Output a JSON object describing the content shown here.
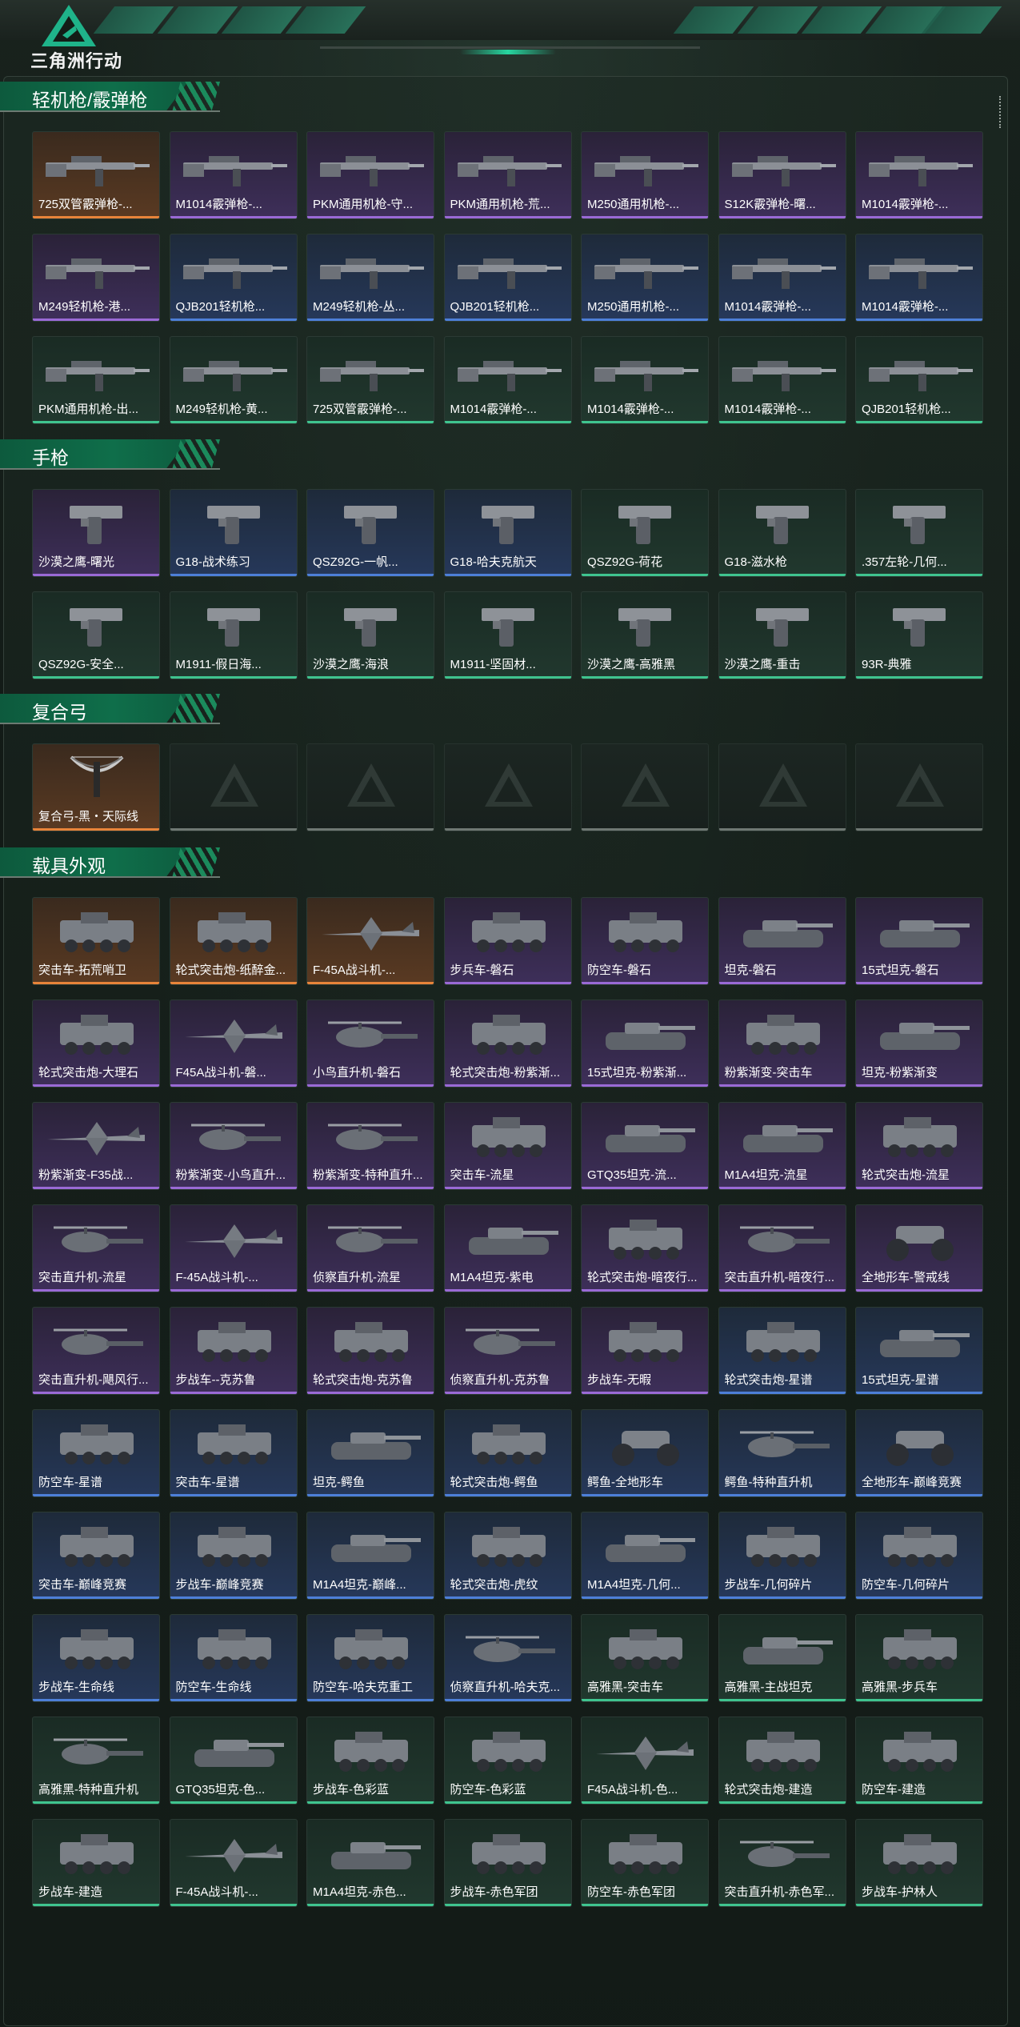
{
  "header": {
    "logo_text": "三角洲行动"
  },
  "sections": [
    {
      "title": "轻机枪/霰弹枪",
      "items": [
        {
          "label": "725双管霰弹枪-...",
          "rarity": "orange",
          "art": "gun-icon"
        },
        {
          "label": "M1014霰弹枪-...",
          "rarity": "purple",
          "art": "gun-icon"
        },
        {
          "label": "PKM通用机枪-守...",
          "rarity": "purple",
          "art": "gun-icon"
        },
        {
          "label": "PKM通用机枪-荒...",
          "rarity": "purple",
          "art": "gun-icon"
        },
        {
          "label": "M250通用机枪-...",
          "rarity": "purple",
          "art": "gun-icon"
        },
        {
          "label": "S12K霰弹枪-曙...",
          "rarity": "purple",
          "art": "gun-icon"
        },
        {
          "label": "M1014霰弹枪-...",
          "rarity": "purple",
          "art": "gun-icon"
        },
        {
          "label": "M249轻机枪-港...",
          "rarity": "purple",
          "art": "gun-icon"
        },
        {
          "label": "QJB201轻机枪...",
          "rarity": "blue",
          "art": "gun-icon"
        },
        {
          "label": "M249轻机枪-丛...",
          "rarity": "blue",
          "art": "gun-icon"
        },
        {
          "label": "QJB201轻机枪...",
          "rarity": "blue",
          "art": "gun-icon"
        },
        {
          "label": "M250通用机枪-...",
          "rarity": "blue",
          "art": "gun-icon"
        },
        {
          "label": "M1014霰弹枪-...",
          "rarity": "blue",
          "art": "gun-icon"
        },
        {
          "label": "M1014霰弹枪-...",
          "rarity": "blue",
          "art": "gun-icon"
        },
        {
          "label": "PKM通用机枪-出...",
          "rarity": "green",
          "art": "gun-icon"
        },
        {
          "label": "M249轻机枪-黄...",
          "rarity": "green",
          "art": "gun-icon"
        },
        {
          "label": "725双管霰弹枪-...",
          "rarity": "green",
          "art": "gun-icon"
        },
        {
          "label": "M1014霰弹枪-...",
          "rarity": "green",
          "art": "gun-icon"
        },
        {
          "label": "M1014霰弹枪-...",
          "rarity": "green",
          "art": "gun-icon"
        },
        {
          "label": "M1014霰弹枪-...",
          "rarity": "green",
          "art": "gun-icon"
        },
        {
          "label": "QJB201轻机枪...",
          "rarity": "green",
          "art": "gun-icon"
        }
      ]
    },
    {
      "title": "手枪",
      "items": [
        {
          "label": "沙漠之鹰-曙光",
          "rarity": "purple",
          "art": "pistol-icon"
        },
        {
          "label": "G18-战术练习",
          "rarity": "blue",
          "art": "pistol-icon"
        },
        {
          "label": "QSZ92G-一帆...",
          "rarity": "blue",
          "art": "pistol-icon"
        },
        {
          "label": "G18-哈夫克航天",
          "rarity": "blue",
          "art": "pistol-icon"
        },
        {
          "label": "QSZ92G-荷花",
          "rarity": "green",
          "art": "pistol-icon"
        },
        {
          "label": "G18-滋水枪",
          "rarity": "green",
          "art": "pistol-icon"
        },
        {
          "label": ".357左轮-几何...",
          "rarity": "green",
          "art": "pistol-icon"
        },
        {
          "label": "QSZ92G-安全...",
          "rarity": "green",
          "art": "pistol-icon"
        },
        {
          "label": "M1911-假日海...",
          "rarity": "green",
          "art": "pistol-icon"
        },
        {
          "label": "沙漠之鹰-海浪",
          "rarity": "green",
          "art": "pistol-icon"
        },
        {
          "label": "M1911-坚固材...",
          "rarity": "green",
          "art": "pistol-icon"
        },
        {
          "label": "沙漠之鹰-高雅黑",
          "rarity": "green",
          "art": "pistol-icon"
        },
        {
          "label": "沙漠之鹰-重击",
          "rarity": "green",
          "art": "pistol-icon"
        },
        {
          "label": "93R-典雅",
          "rarity": "green",
          "art": "pistol-icon"
        }
      ]
    },
    {
      "title": "复合弓",
      "items": [
        {
          "label": "复合弓-黑・天际线",
          "rarity": "orange",
          "art": "bow-icon"
        },
        {
          "label": "",
          "rarity": "empty",
          "art": "placeholder-logo-icon"
        },
        {
          "label": "",
          "rarity": "empty",
          "art": "placeholder-logo-icon"
        },
        {
          "label": "",
          "rarity": "empty",
          "art": "placeholder-logo-icon"
        },
        {
          "label": "",
          "rarity": "empty",
          "art": "placeholder-logo-icon"
        },
        {
          "label": "",
          "rarity": "empty",
          "art": "placeholder-logo-icon"
        },
        {
          "label": "",
          "rarity": "empty",
          "art": "placeholder-logo-icon"
        }
      ]
    },
    {
      "title": "载具外观",
      "items": [
        {
          "label": "突击车-拓荒哨卫",
          "rarity": "orange",
          "art": "vehicle-icon"
        },
        {
          "label": "轮式突击炮-纸醉金...",
          "rarity": "orange",
          "art": "vehicle-icon"
        },
        {
          "label": "F-45A战斗机-...",
          "rarity": "orange",
          "art": "jet-icon"
        },
        {
          "label": "步兵车-磐石",
          "rarity": "purple",
          "art": "vehicle-icon"
        },
        {
          "label": "防空车-磐石",
          "rarity": "purple",
          "art": "vehicle-icon"
        },
        {
          "label": "坦克-磐石",
          "rarity": "purple",
          "art": "tank-icon"
        },
        {
          "label": "15式坦克-磐石",
          "rarity": "purple",
          "art": "tank-icon"
        },
        {
          "label": "轮式突击炮-大理石",
          "rarity": "purple",
          "art": "vehicle-icon"
        },
        {
          "label": "F45A战斗机-磐...",
          "rarity": "purple",
          "art": "jet-icon"
        },
        {
          "label": "小鸟直升机-磐石",
          "rarity": "purple",
          "art": "helicopter-icon"
        },
        {
          "label": "轮式突击炮-粉紫渐...",
          "rarity": "purple",
          "art": "vehicle-icon"
        },
        {
          "label": "15式坦克-粉紫渐...",
          "rarity": "purple",
          "art": "tank-icon"
        },
        {
          "label": "粉紫渐变-突击车",
          "rarity": "purple",
          "art": "vehicle-icon"
        },
        {
          "label": "坦克-粉紫渐变",
          "rarity": "purple",
          "art": "tank-icon"
        },
        {
          "label": "粉紫渐变-F35战...",
          "rarity": "purple",
          "art": "jet-icon"
        },
        {
          "label": "粉紫渐变-小鸟直升...",
          "rarity": "purple",
          "art": "helicopter-icon"
        },
        {
          "label": "粉紫渐变-特种直升...",
          "rarity": "purple",
          "art": "helicopter-icon"
        },
        {
          "label": "突击车-流星",
          "rarity": "purple",
          "art": "vehicle-icon"
        },
        {
          "label": "GTQ35坦克-流...",
          "rarity": "purple",
          "art": "tank-icon"
        },
        {
          "label": "M1A4坦克-流星",
          "rarity": "purple",
          "art": "tank-icon"
        },
        {
          "label": "轮式突击炮-流星",
          "rarity": "purple",
          "art": "vehicle-icon"
        },
        {
          "label": "突击直升机-流星",
          "rarity": "purple",
          "art": "helicopter-icon"
        },
        {
          "label": "F-45A战斗机-...",
          "rarity": "purple",
          "art": "jet-icon"
        },
        {
          "label": "侦察直升机-流星",
          "rarity": "purple",
          "art": "helicopter-icon"
        },
        {
          "label": "M1A4坦克-紫电",
          "rarity": "purple",
          "art": "tank-icon"
        },
        {
          "label": "轮式突击炮-暗夜行...",
          "rarity": "purple",
          "art": "vehicle-icon"
        },
        {
          "label": "突击直升机-暗夜行...",
          "rarity": "purple",
          "art": "helicopter-icon"
        },
        {
          "label": "全地形车-警戒线",
          "rarity": "purple",
          "art": "atv-icon"
        },
        {
          "label": "突击直升机-飓风行...",
          "rarity": "purple",
          "art": "helicopter-icon"
        },
        {
          "label": "步战车--克苏鲁",
          "rarity": "purple",
          "art": "vehicle-icon"
        },
        {
          "label": "轮式突击炮-克苏鲁",
          "rarity": "purple",
          "art": "vehicle-icon"
        },
        {
          "label": "侦察直升机-克苏鲁",
          "rarity": "purple",
          "art": "helicopter-icon"
        },
        {
          "label": "步战车-无暇",
          "rarity": "purple",
          "art": "vehicle-icon"
        },
        {
          "label": "轮式突击炮-星谱",
          "rarity": "blue",
          "art": "vehicle-icon"
        },
        {
          "label": "15式坦克-星谱",
          "rarity": "blue",
          "art": "tank-icon"
        },
        {
          "label": "防空车-星谱",
          "rarity": "blue",
          "art": "vehicle-icon"
        },
        {
          "label": "突击车-星谱",
          "rarity": "blue",
          "art": "vehicle-icon"
        },
        {
          "label": "坦克-鳄鱼",
          "rarity": "blue",
          "art": "tank-icon"
        },
        {
          "label": "轮式突击炮-鳄鱼",
          "rarity": "blue",
          "art": "vehicle-icon"
        },
        {
          "label": "鳄鱼-全地形车",
          "rarity": "blue",
          "art": "atv-icon"
        },
        {
          "label": "鳄鱼-特种直升机",
          "rarity": "blue",
          "art": "helicopter-icon"
        },
        {
          "label": "全地形车-巅峰竞赛",
          "rarity": "blue",
          "art": "atv-icon"
        },
        {
          "label": "突击车-巅峰竞赛",
          "rarity": "blue",
          "art": "vehicle-icon"
        },
        {
          "label": "步战车-巅峰竞赛",
          "rarity": "blue",
          "art": "vehicle-icon"
        },
        {
          "label": "M1A4坦克-巅峰...",
          "rarity": "blue",
          "art": "tank-icon"
        },
        {
          "label": "轮式突击炮-虎纹",
          "rarity": "blue",
          "art": "vehicle-icon"
        },
        {
          "label": "M1A4坦克-几何...",
          "rarity": "blue",
          "art": "tank-icon"
        },
        {
          "label": "步战车-几何碎片",
          "rarity": "blue",
          "art": "vehicle-icon"
        },
        {
          "label": "防空车-几何碎片",
          "rarity": "blue",
          "art": "vehicle-icon"
        },
        {
          "label": "步战车-生命线",
          "rarity": "blue",
          "art": "vehicle-icon"
        },
        {
          "label": "防空车-生命线",
          "rarity": "blue",
          "art": "vehicle-icon"
        },
        {
          "label": "防空车-哈夫克重工",
          "rarity": "blue",
          "art": "vehicle-icon"
        },
        {
          "label": "侦察直升机-哈夫克...",
          "rarity": "blue",
          "art": "helicopter-icon"
        },
        {
          "label": "高雅黑-突击车",
          "rarity": "green",
          "art": "vehicle-icon"
        },
        {
          "label": "高雅黑-主战坦克",
          "rarity": "green",
          "art": "tank-icon"
        },
        {
          "label": "高雅黑-步兵车",
          "rarity": "green",
          "art": "vehicle-icon"
        },
        {
          "label": "高雅黑-特种直升机",
          "rarity": "green",
          "art": "helicopter-icon"
        },
        {
          "label": "GTQ35坦克-色...",
          "rarity": "green",
          "art": "tank-icon"
        },
        {
          "label": "步战车-色彩蓝",
          "rarity": "green",
          "art": "vehicle-icon"
        },
        {
          "label": "防空车-色彩蓝",
          "rarity": "green",
          "art": "vehicle-icon"
        },
        {
          "label": "F45A战斗机-色...",
          "rarity": "green",
          "art": "jet-icon"
        },
        {
          "label": "轮式突击炮-建造",
          "rarity": "green",
          "art": "vehicle-icon"
        },
        {
          "label": "防空车-建造",
          "rarity": "green",
          "art": "vehicle-icon"
        },
        {
          "label": "步战车-建造",
          "rarity": "green",
          "art": "vehicle-icon"
        },
        {
          "label": "F-45A战斗机-...",
          "rarity": "green",
          "art": "jet-icon"
        },
        {
          "label": "M1A4坦克-赤色...",
          "rarity": "green",
          "art": "tank-icon"
        },
        {
          "label": "步战车-赤色军团",
          "rarity": "green",
          "art": "vehicle-icon"
        },
        {
          "label": "防空车-赤色军团",
          "rarity": "green",
          "art": "vehicle-icon"
        },
        {
          "label": "突击直升机-赤色军...",
          "rarity": "green",
          "art": "helicopter-icon"
        },
        {
          "label": "步战车-护林人",
          "rarity": "green",
          "art": "vehicle-icon"
        }
      ]
    }
  ],
  "rarity_colors": {
    "orange": "#e8843a",
    "purple": "#9a6ad6",
    "blue": "#4d7fd8",
    "green": "#3fc48f",
    "empty": "#6f7873"
  }
}
